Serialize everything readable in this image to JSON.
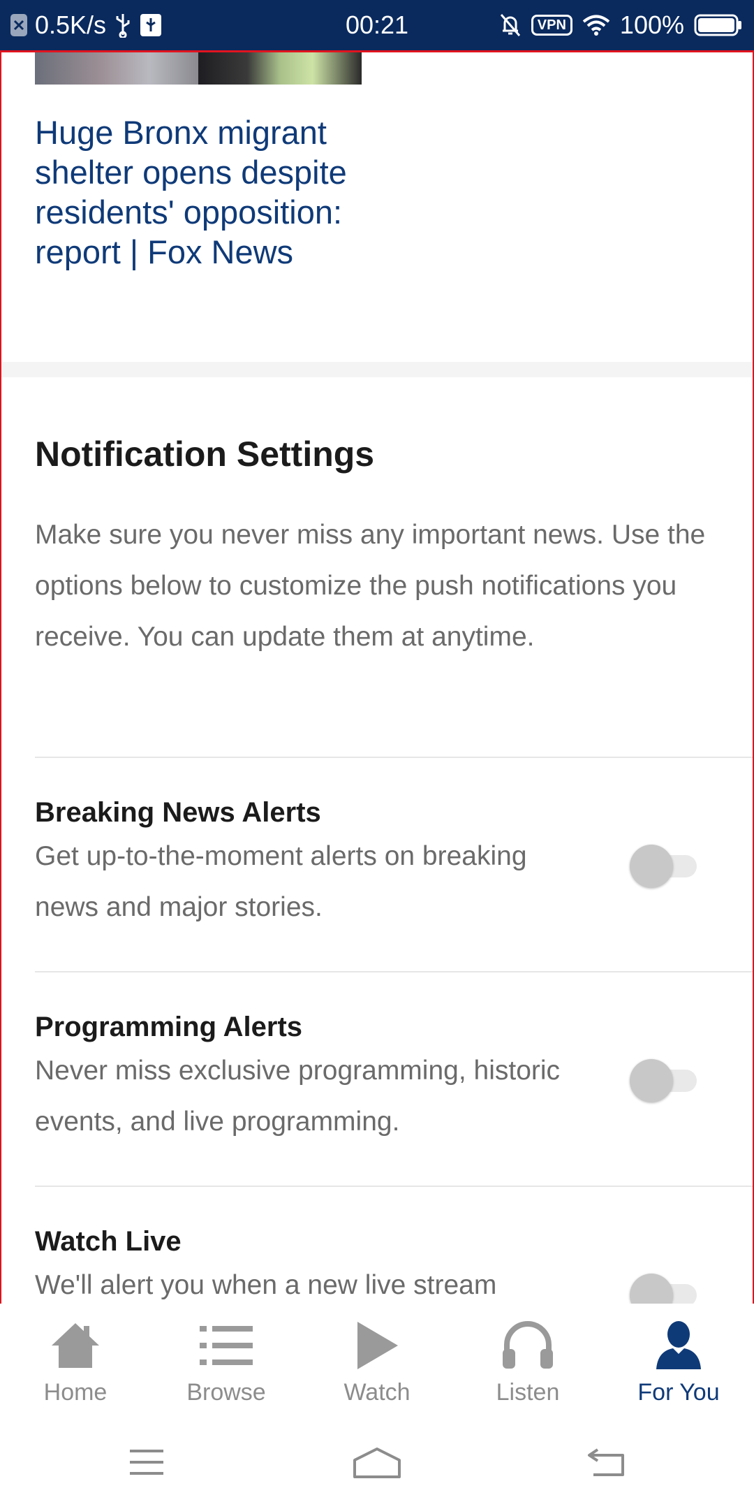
{
  "status_bar": {
    "speed": "0.5K/s",
    "time": "00:21",
    "vpn": "VPN",
    "battery": "100%"
  },
  "article": {
    "headline": "Huge Bronx migrant shelter opens despite residents' opposition: report | Fox News"
  },
  "notification_settings": {
    "title": "Notification Settings",
    "description": "Make sure you never miss any important news. Use the options below to customize the push notifications you receive. You can update them at anytime.",
    "items": [
      {
        "title": "Breaking News Alerts",
        "description": "Get up-to-the-moment alerts on breaking news and major stories.",
        "enabled": false
      },
      {
        "title": "Programming Alerts",
        "description": "Never miss exclusive programming, historic events, and live programming.",
        "enabled": false
      },
      {
        "title": "Watch Live",
        "description": "We'll alert you when a new live stream",
        "enabled": false
      }
    ]
  },
  "bottom_nav": {
    "items": [
      {
        "label": "Home",
        "icon": "home-icon",
        "active": false
      },
      {
        "label": "Browse",
        "icon": "list-icon",
        "active": false
      },
      {
        "label": "Watch",
        "icon": "play-icon",
        "active": false
      },
      {
        "label": "Listen",
        "icon": "headphones-icon",
        "active": false
      },
      {
        "label": "For You",
        "icon": "person-icon",
        "active": true
      }
    ]
  },
  "colors": {
    "status_bar_bg": "#0a2a5e",
    "headline": "#0f3a78",
    "active_nav": "#0f3a78",
    "inactive_nav": "#8c8c8c",
    "frame_border": "#e0141e"
  }
}
